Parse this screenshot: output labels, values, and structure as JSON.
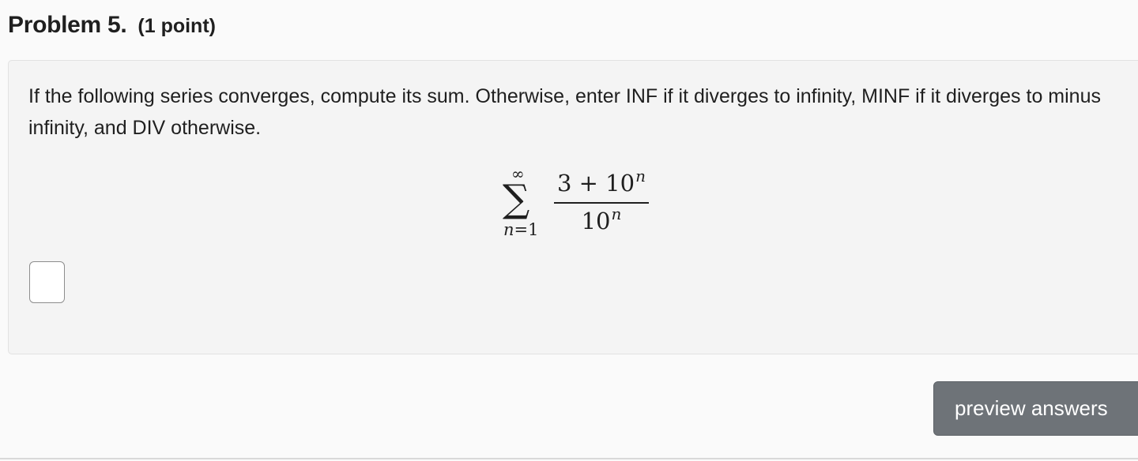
{
  "problem": {
    "title": "Problem 5.",
    "points": "(1 point)",
    "statement": "If the following series converges, compute its sum. Otherwise, enter INF if it diverges to infinity, MINF if it diverges to minus infinity, and DIV otherwise.",
    "formula": {
      "sum_symbol": "∑",
      "upper_limit": "∞",
      "index_var": "n",
      "equals": "=",
      "lower_limit": "1",
      "numerator_base": "3 + 10",
      "numerator_exponent": "n",
      "denominator_base": "10",
      "denominator_exponent": "n"
    },
    "answer": {
      "value": "",
      "placeholder": ""
    }
  },
  "actions": {
    "preview_label": "preview answers"
  },
  "colors": {
    "page_background": "#fafafa",
    "panel_background": "#f4f4f4",
    "button_background": "#6e7378",
    "button_text": "#ffffff"
  }
}
